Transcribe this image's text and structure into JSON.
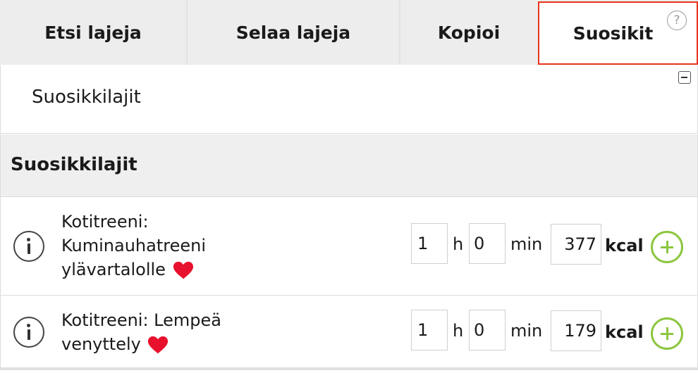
{
  "tabs": [
    {
      "label": "Etsi lajeja",
      "active": false
    },
    {
      "label": "Selaa lajeja",
      "active": false
    },
    {
      "label": "Kopioi",
      "active": false
    },
    {
      "label": "Suosikit",
      "active": true
    }
  ],
  "help": {
    "symbol": "?"
  },
  "panel": {
    "title": "Suosikkilajit"
  },
  "section": {
    "title": "Suosikkilajit"
  },
  "activities": [
    {
      "name_lines": [
        "Kotitreeni:",
        "Kuminauhatreeni",
        "ylävartalolle"
      ],
      "hours": "1",
      "hours_unit": "h",
      "minutes": "0",
      "minutes_unit": "min",
      "kcal": "377",
      "kcal_unit": "kcal",
      "favorite": true
    },
    {
      "name_lines": [
        "Kotitreeni: Lempeä",
        "venyttely"
      ],
      "hours": "1",
      "hours_unit": "h",
      "minutes": "0",
      "minutes_unit": "min",
      "kcal": "179",
      "kcal_unit": "kcal",
      "favorite": true
    }
  ],
  "colors": {
    "active_tab_border": "#e8341c",
    "add_button": "#8cc63f",
    "heart": "#e8112d"
  }
}
